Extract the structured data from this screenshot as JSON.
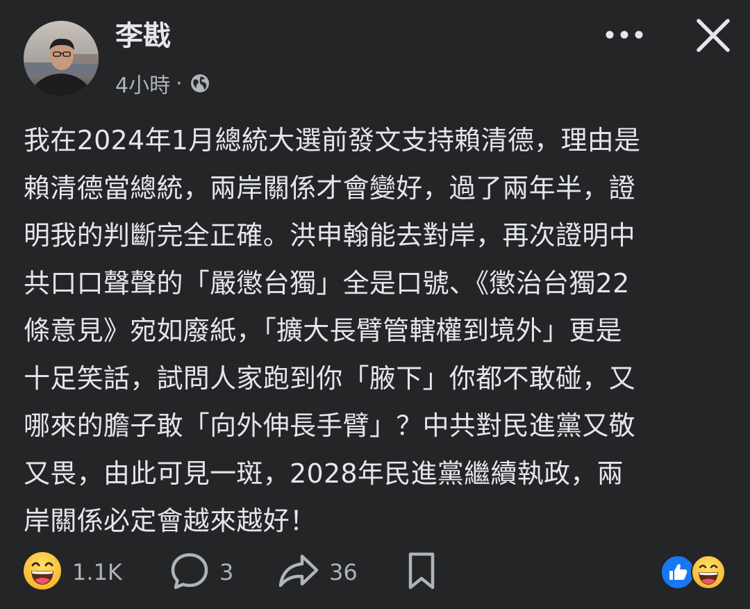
{
  "post": {
    "author": "李戡",
    "time": "4小時",
    "separator": "·",
    "audience_icon": "globe-icon",
    "body_lines": [
      "我在2024年1月總統大選前發文支持賴清德，理由是",
      "賴清德當總統，兩岸關係才會變好，過了兩年半，證",
      "明我的判斷完全正確。洪申翰能去對岸，再次證明中",
      "共口口聲聲的「嚴懲台獨」全是口號、《懲治台獨22",
      "條意見》宛如廢紙，「擴大長臂管轄權到境外」更是",
      "十足笑話，試問人家跑到你「腋下」你都不敢碰，又",
      "哪來的膽子敢「向外伸長手臂」？中共對民進黨又敬",
      "又畏，由此可見一斑，2028年民進黨繼續執政，兩",
      "岸關係必定會越來越好！"
    ]
  },
  "header": {
    "more_icon": "more-horizontal-icon",
    "close_icon": "close-icon"
  },
  "actions": {
    "reaction": {
      "icon": "haha-emoji-icon",
      "count": "1.1K"
    },
    "comment": {
      "icon": "comment-bubble-icon",
      "count": "3"
    },
    "share": {
      "icon": "share-arrow-icon",
      "count": "36"
    },
    "save": {
      "icon": "bookmark-icon"
    },
    "reaction_summary": [
      "like-icon",
      "haha-emoji-icon"
    ]
  },
  "colors": {
    "background": "#242526",
    "text_primary": "#e4e6eb",
    "text_secondary": "#b0b3b8",
    "like_blue": "#1877f2",
    "emoji_yellow": "#f7b125"
  }
}
